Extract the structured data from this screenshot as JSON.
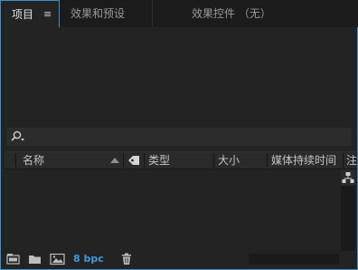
{
  "tabs": {
    "project": "项目",
    "project_menu": "≡",
    "effects_presets": "效果和预设",
    "effect_controls": "效果控件 （无）"
  },
  "search": {
    "placeholder": ""
  },
  "columns": {
    "name": "名称",
    "type": "类型",
    "size": "大小",
    "media_duration": "媒体持续时间",
    "comment": "注"
  },
  "footer": {
    "bit_depth": "8 bpc"
  },
  "colors": {
    "accent": "#3f8ec7",
    "panel_bg": "#232323",
    "bpc_text": "#3f9bd9"
  }
}
